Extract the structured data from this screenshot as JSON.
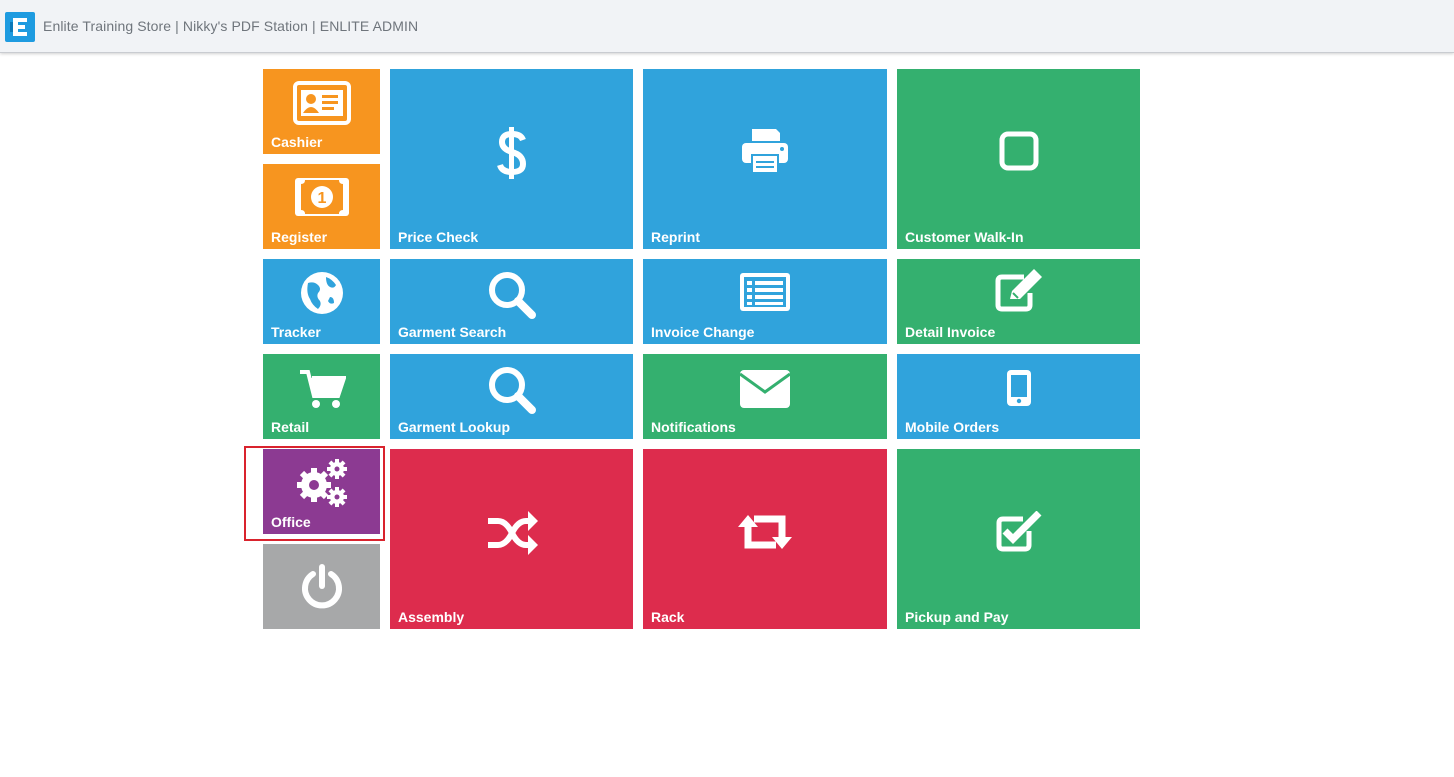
{
  "header": {
    "title": "Enlite Training Store | Nikky's PDF Station | ENLITE ADMIN",
    "logo_icon": "enlite-logo-icon"
  },
  "colors": {
    "orange": "#f7951f",
    "blue": "#30a3dc",
    "green": "#34b06f",
    "purple": "#8c3a92",
    "red": "#dd2c4d",
    "gray": "#a7a8a9",
    "highlight": "#d9232d"
  },
  "tiles": {
    "cashier": {
      "label": "Cashier",
      "icon": "id-card-icon"
    },
    "register": {
      "label": "Register",
      "icon": "money-bill-icon"
    },
    "tracker": {
      "label": "Tracker",
      "icon": "globe-icon"
    },
    "retail": {
      "label": "Retail",
      "icon": "shopping-cart-icon"
    },
    "office": {
      "label": "Office",
      "icon": "gears-icon",
      "highlighted": true
    },
    "power": {
      "label": "",
      "icon": "power-icon"
    },
    "price_check": {
      "label": "Price Check",
      "icon": "dollar-icon"
    },
    "reprint": {
      "label": "Reprint",
      "icon": "printer-icon"
    },
    "customer_walk_in": {
      "label": "Customer Walk-In",
      "icon": "square-icon"
    },
    "garment_search": {
      "label": "Garment Search",
      "icon": "search-icon"
    },
    "invoice_change": {
      "label": "Invoice Change",
      "icon": "list-alt-icon"
    },
    "detail_invoice": {
      "label": "Detail Invoice",
      "icon": "edit-icon"
    },
    "garment_lookup": {
      "label": "Garment Lookup",
      "icon": "search-icon"
    },
    "notifications": {
      "label": "Notifications",
      "icon": "envelope-icon"
    },
    "mobile_orders": {
      "label": "Mobile Orders",
      "icon": "mobile-phone-icon"
    },
    "assembly": {
      "label": "Assembly",
      "icon": "random-icon"
    },
    "rack": {
      "label": "Rack",
      "icon": "retweet-icon"
    },
    "pickup_and_pay": {
      "label": "Pickup and Pay",
      "icon": "check-square-icon"
    }
  }
}
